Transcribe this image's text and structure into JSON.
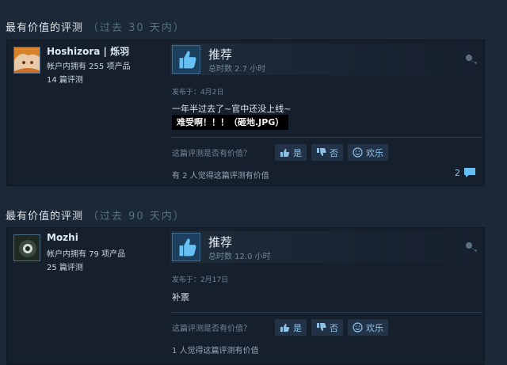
{
  "reviews": [
    {
      "section_title": "最有价值的评测",
      "section_subtitle": "（过去 30 天内）",
      "username": "Hoshizora | 烁羽",
      "products_owned": "帐户内拥有 255 项产品",
      "review_count": "14 篇评测",
      "verdict": "推荐",
      "hours": "总时数 2.7 小时",
      "posted": "发布于：4月2日",
      "body": "一年半过去了~官中还没上线~",
      "spoiler": "难受啊！！！（砸地.JPG）",
      "helpful_question": "这篇评测是否有价值？",
      "yes_label": "是",
      "no_label": "否",
      "funny_label": "欢乐",
      "helpful_count": "有 2 人觉得这篇评测有价值",
      "comment_count": "2",
      "avatar_color": "#d9822b"
    },
    {
      "section_title": "最有价值的评测",
      "section_subtitle": "（过去 90 天内）",
      "username": "Mozhi",
      "products_owned": "帐户内拥有 79 项产品",
      "review_count": "25 篇评测",
      "verdict": "推荐",
      "hours": "总时数 12.0 小时",
      "posted": "发布于：2月17日",
      "body": "补票",
      "helpful_question": "这篇评测是否有价值？",
      "yes_label": "是",
      "no_label": "否",
      "funny_label": "欢乐",
      "helpful_count": "1 人觉得这篇评测有价值",
      "avatar_color": "#2c3a2e"
    }
  ],
  "colors": {
    "background": "#1b2838",
    "card": "#16202d",
    "accent": "#66c0f4",
    "thumb_bg": "#1c3f5d"
  },
  "icons": {
    "thumb": "thumbs-up-icon",
    "key": "key-icon",
    "vote_up": "thumbs-up-icon",
    "vote_down": "thumbs-down-icon",
    "funny": "smiley-icon",
    "comment": "comment-icon"
  }
}
